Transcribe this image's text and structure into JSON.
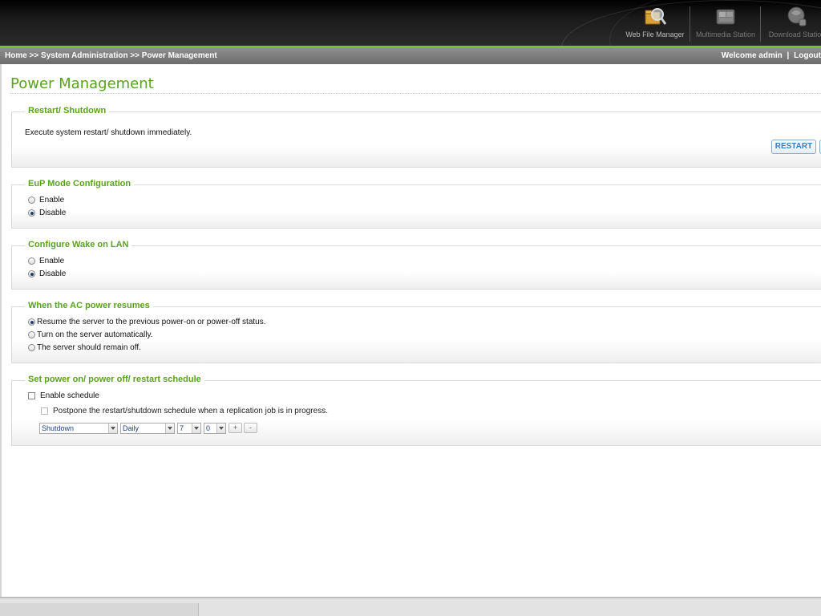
{
  "header": {
    "apps": [
      {
        "label": "Web File Manager",
        "icon": "web-file-manager-icon"
      },
      {
        "label": "Multimedia Station",
        "icon": "multimedia-station-icon"
      },
      {
        "label": "Download Station",
        "icon": "download-station-icon"
      }
    ]
  },
  "breadcrumb": "Home >> System Administration >> Power Management",
  "user": {
    "welcome": "Welcome admin",
    "separator": "|",
    "logout": "Logout"
  },
  "page": {
    "title": "Power Management"
  },
  "sections": {
    "restart": {
      "legend": "Restart/ Shutdown",
      "description": "Execute system restart/ shutdown immediately.",
      "restart_label": "RESTART"
    },
    "eup": {
      "legend": "EuP Mode Configuration",
      "options": [
        "Enable",
        "Disable"
      ],
      "selected": "Disable"
    },
    "wol": {
      "legend": "Configure Wake on LAN",
      "options": [
        "Enable",
        "Disable"
      ],
      "selected": "Disable"
    },
    "ac": {
      "legend": "When the AC power resumes",
      "options": [
        "Resume the server to the previous power-on or power-off status.",
        "Turn on the server automatically.",
        "The server should remain off."
      ],
      "selected": 0
    },
    "schedule": {
      "legend": "Set power on/ power off/ restart schedule",
      "enable_label": "Enable schedule",
      "postpone_label": "Postpone the restart/shutdown schedule when a replication job is in progress.",
      "action": "Shutdown",
      "frequency": "Daily",
      "hour": "7",
      "minute": "0",
      "add_label": "+",
      "remove_label": "-"
    }
  },
  "colors": {
    "accent_green": "#59a21d",
    "header_line": "#7cc121",
    "button_text": "#2f7fc9"
  }
}
